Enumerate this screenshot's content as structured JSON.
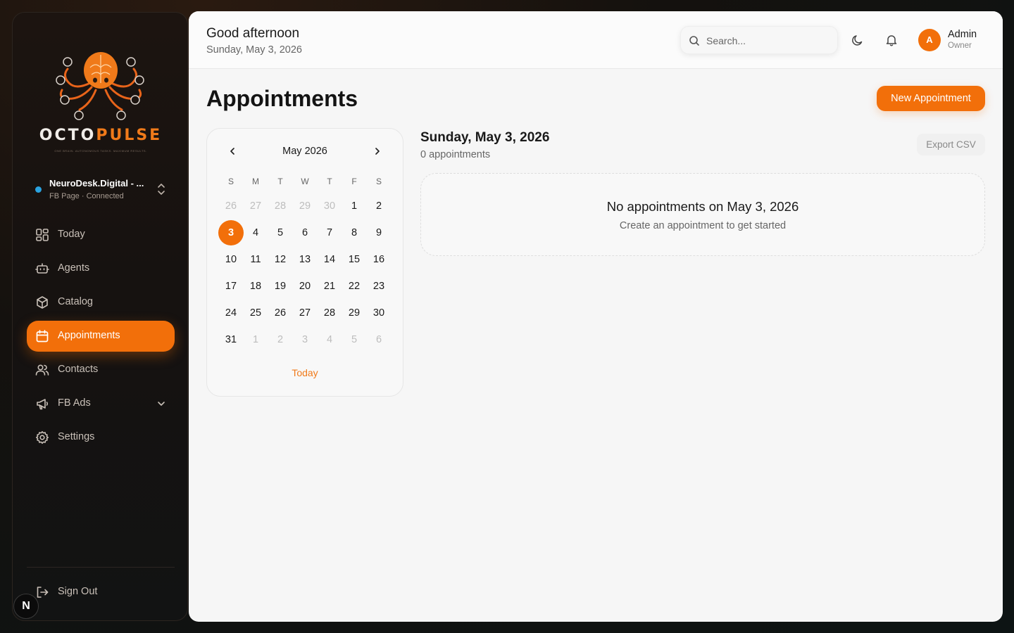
{
  "brand": {
    "name_part1": "OCTO",
    "name_part2": "PULSE",
    "tagline": "ONE BRAIN. AUTONOMOUS TASKS. MAXIMUM RESULTS.",
    "accent_color": "#f26f0a"
  },
  "workspace": {
    "name": "NeuroDesk.Digital - ...",
    "status": "FB Page · Connected",
    "status_color": "#2aa3e0"
  },
  "sidebar": {
    "items": [
      {
        "label": "Today",
        "icon": "grid-icon"
      },
      {
        "label": "Agents",
        "icon": "robot-icon"
      },
      {
        "label": "Catalog",
        "icon": "cube-icon"
      },
      {
        "label": "Appointments",
        "icon": "calendar-icon",
        "active": true
      },
      {
        "label": "Contacts",
        "icon": "users-icon"
      },
      {
        "label": "FB Ads",
        "icon": "megaphone-icon",
        "expandable": true
      },
      {
        "label": "Settings",
        "icon": "gear-icon"
      }
    ],
    "sign_out": "Sign Out",
    "badge": "N"
  },
  "header": {
    "greeting": "Good afternoon",
    "date": "Sunday, May 3, 2026",
    "search_placeholder": "Search...",
    "user": {
      "initial": "A",
      "name": "Admin",
      "role": "Owner"
    }
  },
  "page": {
    "title": "Appointments",
    "new_button": "New Appointment"
  },
  "calendar": {
    "month_label": "May 2026",
    "weekdays": [
      "S",
      "M",
      "T",
      "W",
      "T",
      "F",
      "S"
    ],
    "weeks": [
      [
        {
          "d": "26",
          "m": true
        },
        {
          "d": "27",
          "m": true
        },
        {
          "d": "28",
          "m": true
        },
        {
          "d": "29",
          "m": true
        },
        {
          "d": "30",
          "m": true
        },
        {
          "d": "1"
        },
        {
          "d": "2"
        }
      ],
      [
        {
          "d": "3",
          "s": true
        },
        {
          "d": "4"
        },
        {
          "d": "5"
        },
        {
          "d": "6"
        },
        {
          "d": "7"
        },
        {
          "d": "8"
        },
        {
          "d": "9"
        }
      ],
      [
        {
          "d": "10"
        },
        {
          "d": "11"
        },
        {
          "d": "12"
        },
        {
          "d": "13"
        },
        {
          "d": "14"
        },
        {
          "d": "15"
        },
        {
          "d": "16"
        }
      ],
      [
        {
          "d": "17"
        },
        {
          "d": "18"
        },
        {
          "d": "19"
        },
        {
          "d": "20"
        },
        {
          "d": "21"
        },
        {
          "d": "22"
        },
        {
          "d": "23"
        }
      ],
      [
        {
          "d": "24"
        },
        {
          "d": "25"
        },
        {
          "d": "26"
        },
        {
          "d": "27"
        },
        {
          "d": "28"
        },
        {
          "d": "29"
        },
        {
          "d": "30"
        }
      ],
      [
        {
          "d": "31"
        },
        {
          "d": "1",
          "m": true
        },
        {
          "d": "2",
          "m": true
        },
        {
          "d": "3",
          "m": true
        },
        {
          "d": "4",
          "m": true
        },
        {
          "d": "5",
          "m": true
        },
        {
          "d": "6",
          "m": true
        }
      ]
    ],
    "today_label": "Today"
  },
  "detail": {
    "date_title": "Sunday, May 3, 2026",
    "count": "0 appointments",
    "export_label": "Export CSV",
    "empty_title": "No appointments on May 3, 2026",
    "empty_subtitle": "Create an appointment to get started"
  }
}
